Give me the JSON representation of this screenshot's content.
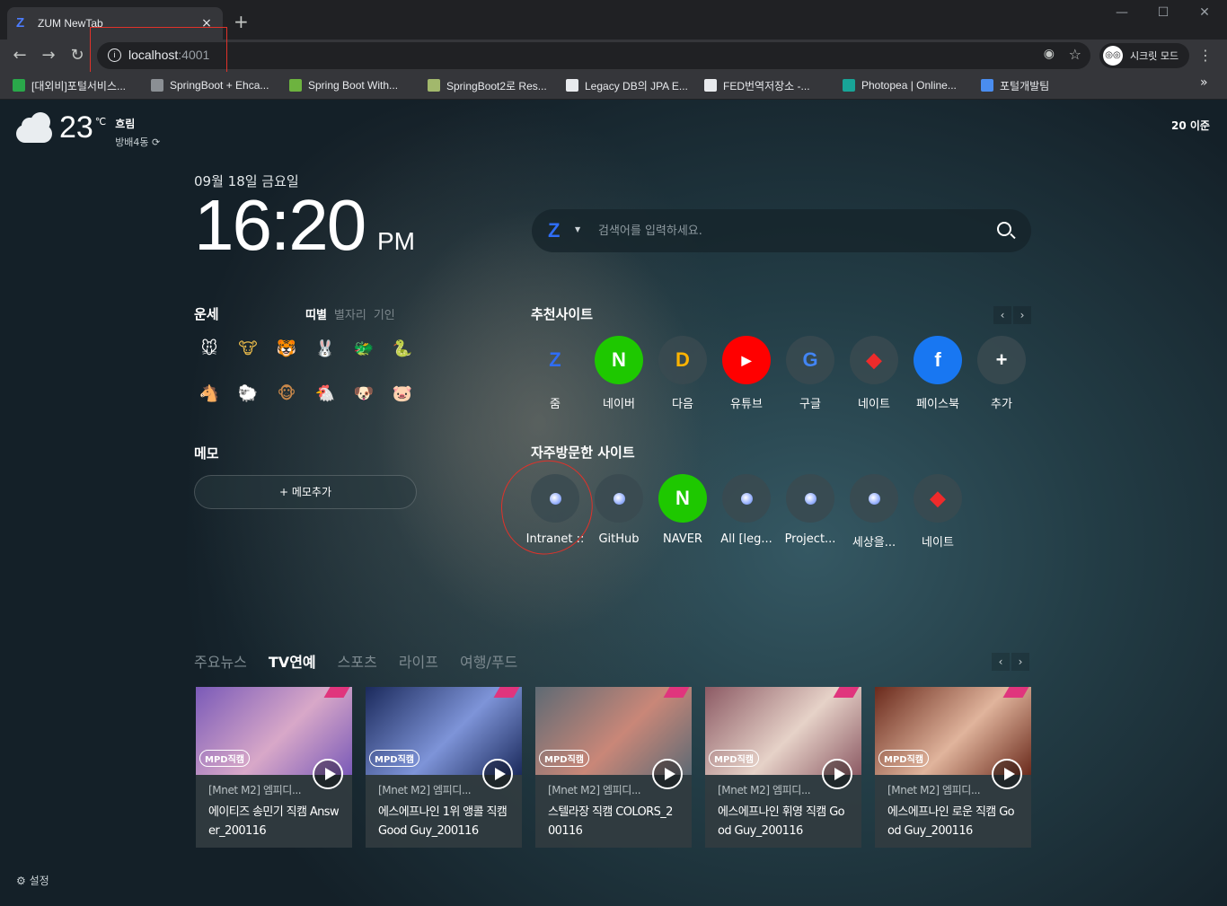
{
  "browser": {
    "tab_title": "ZUM NewTab",
    "tab_close": "×",
    "new_tab": "+",
    "win_min": "—",
    "win_max": "☐",
    "win_close": "✕",
    "back": "←",
    "forward": "→",
    "reload": "↻",
    "url_host": "localhost",
    "url_port": ":4001",
    "incognito_label": "시크릿 모드",
    "menu": "⋮",
    "bookmarks": [
      {
        "label": "[대외비]포털서비스...",
        "color": "#2aa84a"
      },
      {
        "label": "SpringBoot + Ehca...",
        "color": "#8b8f94"
      },
      {
        "label": "Spring Boot With...",
        "color": "#6db33f"
      },
      {
        "label": "SpringBoot2로 Res...",
        "color": "#a2b86c"
      },
      {
        "label": "Legacy DB의 JPA E...",
        "color": "#e8eaed"
      },
      {
        "label": "FED번역저장소 -...",
        "color": "#e8eaed"
      },
      {
        "label": "Photopea | Online...",
        "color": "#18a497"
      },
      {
        "label": "포털개발팀",
        "color": "#4a8df0"
      }
    ],
    "bookmarks_more": "»"
  },
  "weather": {
    "temp": "23",
    "unit": "℃",
    "condition": "흐림",
    "location": "방배4동 ⟳"
  },
  "prev_label": "20 이준",
  "date": "09월 18일 금요일",
  "time": "16:20",
  "ampm": "PM",
  "search": {
    "logo": "Z",
    "caret": "▼",
    "placeholder": "검색어를 입력하세요."
  },
  "fortune": {
    "title": "운세",
    "tabs": [
      "띠별",
      "별자리",
      "기인"
    ],
    "animals": [
      "🐭",
      "🐮",
      "🐯",
      "🐰",
      "🐲",
      "🐍",
      "🐴",
      "🐑",
      "🐵",
      "🐔",
      "🐶",
      "🐷"
    ]
  },
  "memo": {
    "title": "메모",
    "add_label": "+ 메모추가"
  },
  "recommended": {
    "title": "추천사이트",
    "prev": "‹",
    "next": "›",
    "sites": [
      {
        "label": "줌",
        "glyph": "Z",
        "fg": "#2f6df6",
        "bg": "transparent"
      },
      {
        "label": "네이버",
        "glyph": "N",
        "fg": "#ffffff",
        "bg": "#1ec800"
      },
      {
        "label": "다음",
        "glyph": "D",
        "fg": "#ffb300",
        "bg": "rgba(58,74,80,0.85)"
      },
      {
        "label": "유튜브",
        "glyph": "▶",
        "fg": "#ffffff",
        "bg": "#ff0000"
      },
      {
        "label": "구글",
        "glyph": "G",
        "fg": "#4285f4",
        "bg": "rgba(58,74,80,0.85)"
      },
      {
        "label": "네이트",
        "glyph": "◆",
        "fg": "#ee2b2b",
        "bg": "rgba(58,74,80,0.85)"
      },
      {
        "label": "페이스북",
        "glyph": "f",
        "fg": "#ffffff",
        "bg": "#1877f2"
      },
      {
        "label": "추가",
        "glyph": "+",
        "fg": "#ffffff",
        "bg": "rgba(58,74,80,0.85)"
      }
    ]
  },
  "frequent": {
    "title": "자주방문한 사이트",
    "sites": [
      {
        "label": "Intranet ::",
        "type": "globe"
      },
      {
        "label": "GitHub",
        "type": "globe"
      },
      {
        "label": "NAVER",
        "type": "naver"
      },
      {
        "label": "All [leg...",
        "type": "globe"
      },
      {
        "label": "Project...",
        "type": "globe"
      },
      {
        "label": "세상을...",
        "type": "globe"
      },
      {
        "label": "네이트",
        "type": "nate"
      }
    ]
  },
  "news": {
    "tabs": [
      "주요뉴스",
      "TV연예",
      "스포츠",
      "라이프",
      "여행/푸드"
    ],
    "active_tab": 1,
    "prev": "‹",
    "next": "›",
    "cards": [
      {
        "source": "[Mnet M2] 엠피디...",
        "title": "에이티즈 송민기 직캠 Answer_200116",
        "mpd": "MPD직캠",
        "thumb_a": "#7a5ab8",
        "thumb_b": "#d8a8c8"
      },
      {
        "source": "[Mnet M2] 엠피디...",
        "title": "에스에프나인 1위 앵콜 직캠 Good Guy_200116",
        "mpd": "MPD직캠",
        "thumb_a": "#1b2a5c",
        "thumb_b": "#7e94d8"
      },
      {
        "source": "[Mnet M2] 엠피디...",
        "title": "스텔라장 직캠 COLORS_200116",
        "mpd": "MPD직캠",
        "thumb_a": "#5e6a74",
        "thumb_b": "#c98778"
      },
      {
        "source": "[Mnet M2] 엠피디...",
        "title": "에스에프나인 휘영 직캠 Good Guy_200116",
        "mpd": "MPD직캠",
        "thumb_a": "#8c5a64",
        "thumb_b": "#e6d2c8"
      },
      {
        "source": "[Mnet M2] 엠피디...",
        "title": "에스에프나인 로운 직캠 Good Guy_200116",
        "mpd": "MPD직캠",
        "thumb_a": "#6a2a1c",
        "thumb_b": "#e0b49c"
      }
    ]
  },
  "settings_label": "⚙ 설정"
}
